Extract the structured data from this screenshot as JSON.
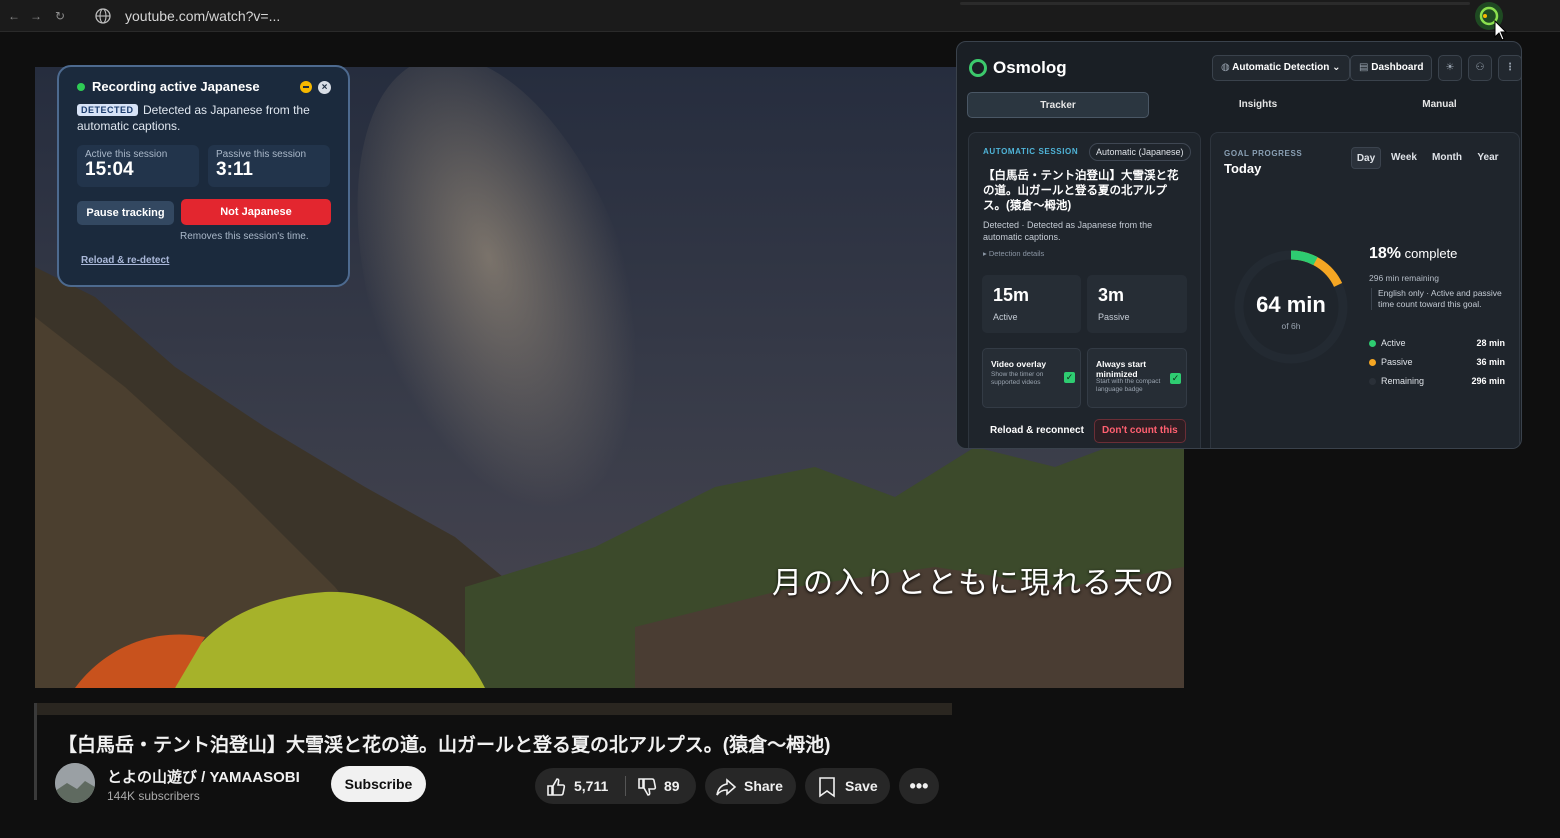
{
  "browser": {
    "url": "youtube.com/watch?v=..."
  },
  "video": {
    "caption": "月の入りとともに現れる天の",
    "title": "【白馬岳・テント泊登山】大雪渓と花の道。山ガールと登る夏の北アルプス。(猿倉〜栂池)",
    "channel": "とよの山遊び / YAMAASOBI",
    "subscribers": "144K subscribers",
    "subscribe_label": "Subscribe",
    "likes": "5,711",
    "dislikes": "89",
    "share_label": "Share",
    "save_label": "Save"
  },
  "overlay": {
    "title": "Recording active Japanese",
    "badge": "DETECTED",
    "description": "Detected as Japanese from the automatic captions.",
    "active_label": "Active this session",
    "active_value": "15:04",
    "passive_label": "Passive this session",
    "passive_value": "3:11",
    "pause_label": "Pause tracking",
    "not_lang_label": "Not Japanese",
    "note": "Removes this session's time.",
    "reload_label": "Reload & re-detect"
  },
  "panel": {
    "brand": "Osmolog",
    "detection_mode": "Automatic Detection",
    "dashboard_label": "Dashboard",
    "tabs": [
      "Tracker",
      "Insights",
      "Manual"
    ],
    "session": {
      "label": "AUTOMATIC SESSION",
      "pill": "Automatic (Japanese)",
      "title": "【白馬岳・テント泊登山】大雪渓と花の道。山ガールと登る夏の北アルプス。(猿倉〜栂池)",
      "detected": "Detected · Detected as Japanese from the automatic captions.",
      "details": "▸ Detection details",
      "active_value": "15m",
      "active_label": "Active",
      "passive_value": "3m",
      "passive_label": "Passive",
      "opt1_title": "Video overlay",
      "opt1_desc": "Show the timer on supported videos",
      "opt2_title": "Always start minimized",
      "opt2_desc": "Start with the compact language badge",
      "reload_label": "Reload & reconnect",
      "dont_count_label": "Don't count this"
    },
    "goal": {
      "label": "GOAL PROGRESS",
      "period": "Today",
      "ranges": [
        "Day",
        "Week",
        "Month",
        "Year"
      ],
      "total": "64 min",
      "of": "of 6h",
      "percent": "18%",
      "percent_suffix": "complete",
      "remaining_text": "296 min remaining",
      "note": "English only · Active and passive time count toward this goal.",
      "progress_fraction": 0.18,
      "active_fraction": 0.078,
      "legend": [
        {
          "name": "Active",
          "value": "28 min",
          "color": "#2ecc71"
        },
        {
          "name": "Passive",
          "value": "36 min",
          "color": "#f5a623"
        },
        {
          "name": "Remaining",
          "value": "296 min",
          "color": "#2a3038"
        }
      ]
    }
  }
}
